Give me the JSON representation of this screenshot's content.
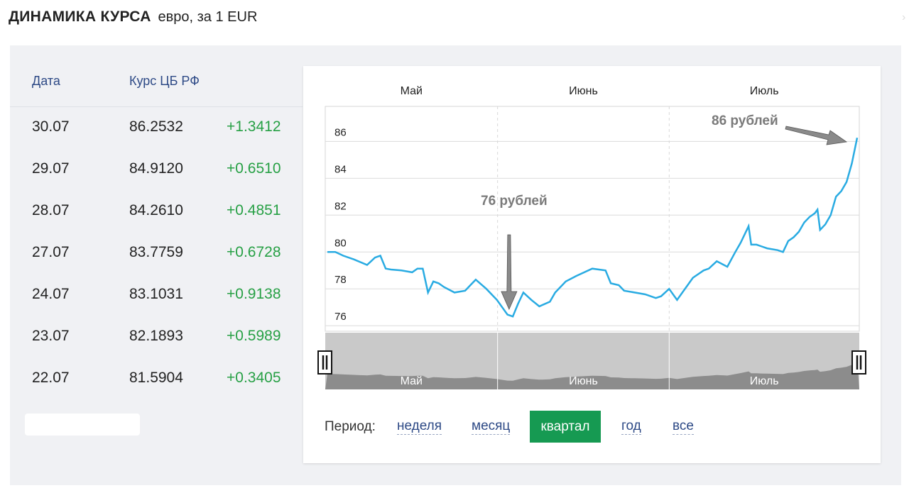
{
  "header": {
    "title_bold": "ДИНАМИКА КУРСА",
    "title_rest": "евро, за 1 EUR"
  },
  "table": {
    "columns": [
      "Дата",
      "Курс ЦБ РФ"
    ],
    "rows": [
      {
        "date": "30.07",
        "rate": "86.2532",
        "change": "+1.3412"
      },
      {
        "date": "29.07",
        "rate": "84.9120",
        "change": "+0.6510"
      },
      {
        "date": "28.07",
        "rate": "84.2610",
        "change": "+0.4851"
      },
      {
        "date": "27.07",
        "rate": "83.7759",
        "change": "+0.6728"
      },
      {
        "date": "24.07",
        "rate": "83.1031",
        "change": "+0.9138"
      },
      {
        "date": "23.07",
        "rate": "82.1893",
        "change": "+0.5989"
      },
      {
        "date": "22.07",
        "rate": "81.5904",
        "change": "+0.3405"
      }
    ]
  },
  "period": {
    "label": "Период:",
    "options": [
      "неделя",
      "месяц",
      "квартал",
      "год",
      "все"
    ],
    "active": "квартал"
  },
  "colors": {
    "line": "#29abe2",
    "change_positive": "#27a045",
    "active_button": "#169a52",
    "link": "#2e4a86"
  },
  "chart_data": {
    "type": "line",
    "months": [
      "Май",
      "Июнь",
      "Июль"
    ],
    "yticks": [
      76,
      78,
      80,
      82,
      84,
      86
    ],
    "ylim": [
      75.7,
      87.9
    ],
    "xlim": [
      0,
      100
    ],
    "grid": true,
    "annotations": [
      {
        "text": "76 рублей",
        "x": 34.3,
        "y": 77.4
      },
      {
        "text": "86 рублей",
        "x": 100,
        "y": 86.2
      }
    ],
    "series": [
      {
        "x": [
          0,
          1.5,
          3,
          5,
          7.5,
          9,
          10,
          11,
          12,
          14,
          16,
          17,
          18,
          19,
          20,
          21,
          22,
          24,
          26,
          27,
          28,
          30,
          32,
          34,
          35,
          36,
          37,
          38.5,
          40,
          42,
          43,
          45,
          47,
          50,
          52.5,
          53.5,
          55,
          56,
          58,
          60,
          62,
          63,
          64.5,
          66,
          68,
          69,
          71,
          72,
          73.5,
          75.5,
          77,
          78,
          79.5,
          80,
          81,
          82,
          83,
          85,
          86,
          87,
          88,
          89,
          90,
          91,
          92,
          92.5,
          93,
          94,
          95,
          96,
          97,
          98,
          99,
          100
        ],
        "y": [
          80.0,
          80.0,
          79.8,
          79.6,
          79.3,
          79.7,
          79.8,
          79.1,
          79.05,
          79.0,
          78.9,
          79.1,
          79.1,
          77.8,
          78.4,
          78.3,
          78.1,
          77.8,
          77.9,
          78.2,
          78.5,
          78.0,
          77.4,
          76.6,
          76.5,
          77.2,
          77.8,
          77.4,
          77.05,
          77.3,
          77.8,
          78.4,
          78.7,
          79.1,
          79.0,
          78.3,
          78.2,
          77.9,
          77.8,
          77.7,
          77.5,
          77.6,
          78.0,
          77.4,
          78.2,
          78.6,
          79.0,
          79.1,
          79.5,
          79.2,
          80.0,
          80.5,
          81.4,
          80.4,
          80.4,
          80.3,
          80.2,
          80.1,
          80.0,
          80.6,
          80.8,
          81.1,
          81.6,
          81.9,
          82.1,
          82.3,
          81.2,
          81.5,
          82.0,
          83.0,
          83.3,
          83.8,
          84.8,
          86.2
        ]
      }
    ]
  }
}
